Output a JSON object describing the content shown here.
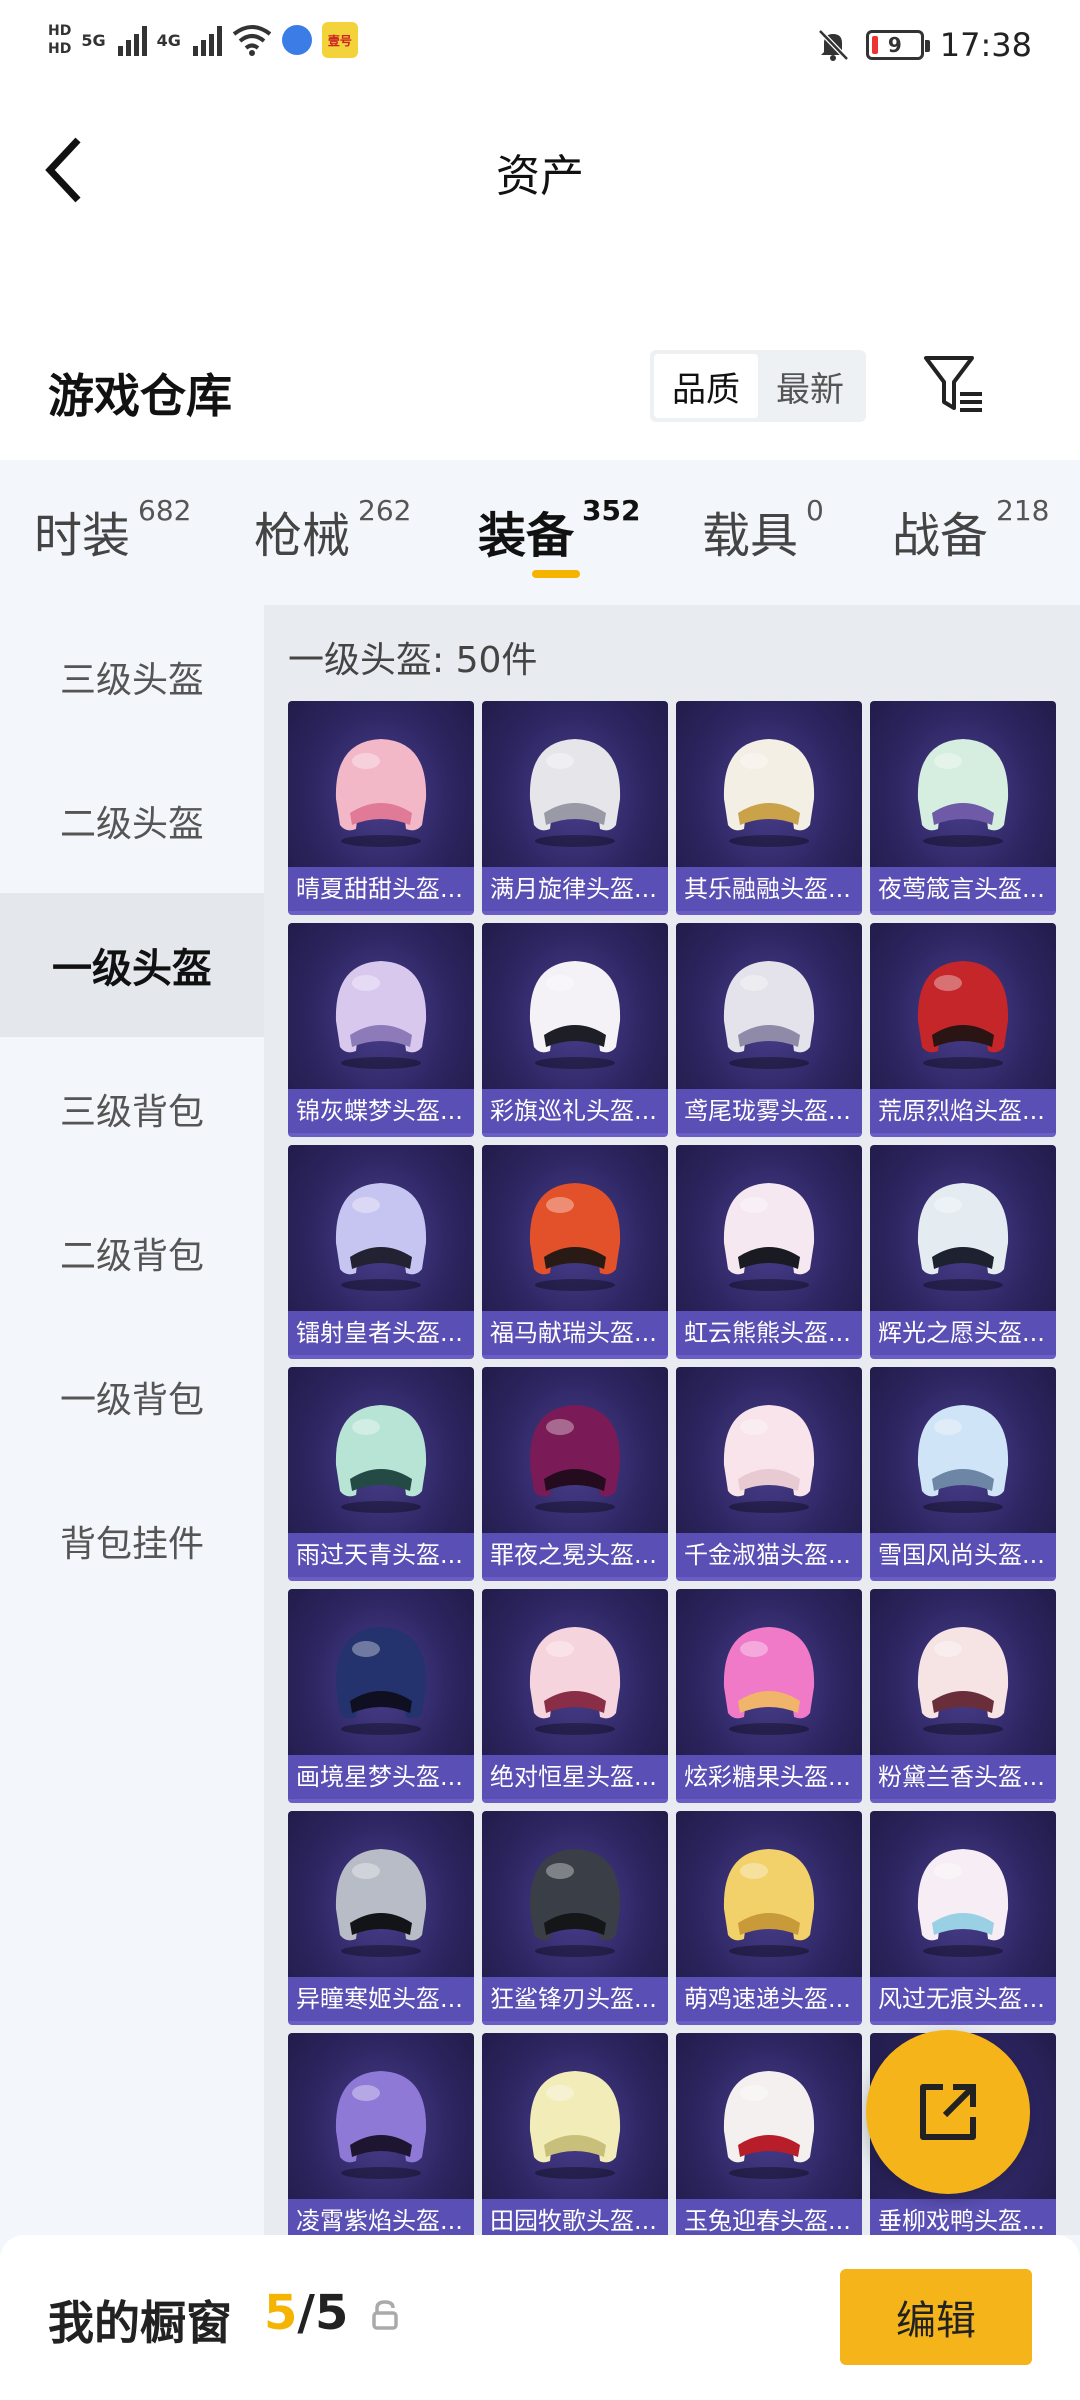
{
  "status_bar": {
    "hd1": "HD",
    "hd2": "HD",
    "net1": "5G",
    "net2": "4G",
    "app_badge": "壹号",
    "battery": "9",
    "time": "17:38"
  },
  "header": {
    "title": "资产"
  },
  "section": {
    "title": "游戏仓库",
    "sort_options": [
      "品质",
      "最新"
    ],
    "active_sort": 0
  },
  "tabs": [
    {
      "label": "时装",
      "count": "682"
    },
    {
      "label": "枪械",
      "count": "262"
    },
    {
      "label": "装备",
      "count": "352"
    },
    {
      "label": "载具",
      "count": "0"
    },
    {
      "label": "战备",
      "count": "218"
    }
  ],
  "active_tab": 2,
  "sidebar": {
    "items": [
      "三级头盔",
      "二级头盔",
      "一级头盔",
      "三级背包",
      "二级背包",
      "一级背包",
      "背包挂件"
    ],
    "active": 2
  },
  "content": {
    "title": "一级头盔: 50件",
    "items": [
      {
        "name": "晴夏甜甜头盔...",
        "color": "#f2b8c8",
        "visor": "#e07a96"
      },
      {
        "name": "满月旋律头盔...",
        "color": "#e6e6ea",
        "visor": "#9a9aa6"
      },
      {
        "name": "其乐融融头盔...",
        "color": "#f4efe4",
        "visor": "#c9a24a"
      },
      {
        "name": "夜莺箴言头盔...",
        "color": "#d6eee0",
        "visor": "#6e5aa6"
      },
      {
        "name": "锦灰蝶梦头盔...",
        "color": "#d9c8ee",
        "visor": "#8d7ab8"
      },
      {
        "name": "彩旗巡礼头盔...",
        "color": "#f4f2f6",
        "visor": "#1e1e26"
      },
      {
        "name": "鸢尾珑雾头盔...",
        "color": "#e4e2ea",
        "visor": "#8e8aa8"
      },
      {
        "name": "荒原烈焰头盔...",
        "color": "#c4262a",
        "visor": "#2a1414"
      },
      {
        "name": "镭射皇者头盔...",
        "color": "#c6c4f0",
        "visor": "#222233"
      },
      {
        "name": "福马献瑞头盔...",
        "color": "#e2512a",
        "visor": "#2a1a16"
      },
      {
        "name": "虹云熊熊头盔...",
        "color": "#f6e8f0",
        "visor": "#1a1a22"
      },
      {
        "name": "辉光之愿头盔...",
        "color": "#e4ecf2",
        "visor": "#1e2230"
      },
      {
        "name": "雨过天青头盔...",
        "color": "#b8e4d6",
        "visor": "#234a44"
      },
      {
        "name": "罪夜之冕头盔...",
        "color": "#7a1a56",
        "visor": "#240c1e"
      },
      {
        "name": "千金淑猫头盔...",
        "color": "#f8e4ea",
        "visor": "#e8cad2"
      },
      {
        "name": "雪国风尚头盔...",
        "color": "#cfe4f6",
        "visor": "#6e86a6"
      },
      {
        "name": "画境星梦头盔...",
        "color": "#24326e",
        "visor": "#0e1022"
      },
      {
        "name": "绝对恒星头盔...",
        "color": "#f6d4de",
        "visor": "#8a2e48"
      },
      {
        "name": "炫彩糖果头盔...",
        "color": "#f07ac8",
        "visor": "#f0b46a"
      },
      {
        "name": "粉黛兰香头盔...",
        "color": "#f6e4e4",
        "visor": "#6a2e3a"
      },
      {
        "name": "异瞳寒姬头盔...",
        "color": "#b8bcc6",
        "visor": "#121418"
      },
      {
        "name": "狂鲨锋刃头盔...",
        "color": "#3a3e46",
        "visor": "#141618"
      },
      {
        "name": "萌鸡速递头盔...",
        "color": "#f2d06a",
        "visor": "#c89a3a"
      },
      {
        "name": "风过无痕头盔...",
        "color": "#f6eef4",
        "visor": "#9ad0e4"
      },
      {
        "name": "凌霄紫焰头盔...",
        "color": "#8e7ad6",
        "visor": "#1e1630"
      },
      {
        "name": "田园牧歌头盔...",
        "color": "#f2ecb8",
        "visor": "#c8c07a"
      },
      {
        "name": "玉兔迎春头盔...",
        "color": "#f4f0f0",
        "visor": "#b81e2a"
      },
      {
        "name": "垂柳戏鸭头盔...",
        "color": "#f6d070",
        "visor": "#e8a83a"
      }
    ]
  },
  "bottom_bar": {
    "label": "我的橱窗",
    "used": "5",
    "separator": "/",
    "total": "5",
    "edit_label": "编辑"
  }
}
